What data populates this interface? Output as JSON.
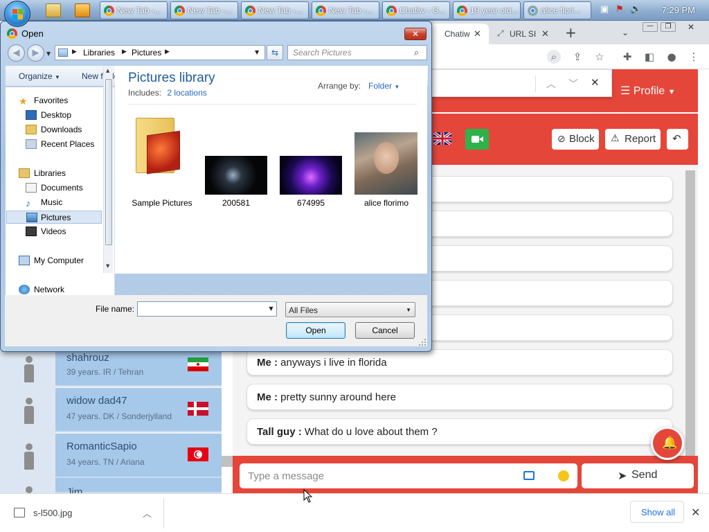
{
  "taskbar": {
    "tasks": [
      {
        "label": "New Tab -..."
      },
      {
        "label": "New Tab -..."
      },
      {
        "label": "New Tab -..."
      },
      {
        "label": "New Tab -..."
      },
      {
        "label": "Chatiw - G..."
      },
      {
        "label": "19 year old..."
      },
      {
        "label": "alice flori..."
      }
    ],
    "clock": "7:29 PM"
  },
  "browser": {
    "tabs": [
      {
        "label": "Chatiw"
      },
      {
        "label": "URL SI"
      }
    ],
    "new_tab_symbol": "+",
    "profile_menu": "Profile"
  },
  "chat": {
    "head_buttons": {
      "block": "Block",
      "report": "Report"
    },
    "messages": [
      {
        "who": "",
        "text": ""
      },
      {
        "who": "",
        "text": ""
      },
      {
        "who": "",
        "text": ""
      },
      {
        "who": "",
        "text": ""
      },
      {
        "who": "",
        "text": ""
      },
      {
        "who": "Me :",
        "text": "anyways i live in florida"
      },
      {
        "who": "Me :",
        "text": "pretty sunny around here"
      },
      {
        "who": "Tall guy :",
        "text": "What do u love about them ?"
      }
    ],
    "composer": {
      "placeholder": "Type a message",
      "send_label": "Send"
    }
  },
  "users": [
    {
      "name": "shahrouz",
      "meta": "39 years. IR / Tehran",
      "flag": "IR"
    },
    {
      "name": "widow dad47",
      "meta": "47 years. DK / Sonderjylland",
      "flag": "DK"
    },
    {
      "name": "RomanticSapio",
      "meta": "34 years. TN / Ariana",
      "flag": "TN"
    },
    {
      "name": "Jim",
      "meta": "",
      "flag": ""
    }
  ],
  "downloads": {
    "file": "s-l500.jpg",
    "show_all": "Show all"
  },
  "dialog": {
    "title": "Open",
    "breadcrumb": [
      "Libraries",
      "Pictures"
    ],
    "search_placeholder": "Search Pictures",
    "commands": {
      "organize": "Organize",
      "new_folder": "New folder"
    },
    "nav": {
      "favorites_header": "Favorites",
      "favorites": [
        "Desktop",
        "Downloads",
        "Recent Places"
      ],
      "libraries_header": "Libraries",
      "libraries": [
        "Documents",
        "Music",
        "Pictures",
        "Videos"
      ],
      "computer": "My Computer",
      "network": "Network"
    },
    "library": {
      "title": "Pictures library",
      "includes_label": "Includes:",
      "includes_link": "2 locations",
      "arrange_label": "Arrange by:",
      "arrange_value": "Folder"
    },
    "files": [
      {
        "name": "Sample Pictures"
      },
      {
        "name": "200581"
      },
      {
        "name": "674995"
      },
      {
        "name": "alice florimo"
      }
    ],
    "filename_label": "File name:",
    "filename_value": "",
    "filetype": "All Files",
    "open_label": "Open",
    "cancel_label": "Cancel"
  },
  "colors": {
    "site_red": "#e5463a",
    "user_row_blue": "#a6c8e9",
    "link_blue": "#2a6ac0",
    "video_green": "#2eb24a"
  }
}
